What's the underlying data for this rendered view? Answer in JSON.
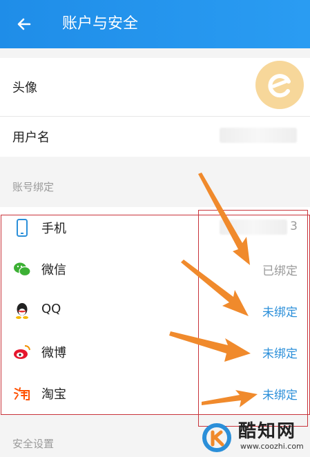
{
  "header": {
    "title": "账户与安全"
  },
  "profile": {
    "avatar_label": "头像",
    "username_label": "用户名"
  },
  "binding_section": {
    "title": "账号绑定",
    "items": [
      {
        "name": "手机",
        "status": "3",
        "icon": "phone-icon"
      },
      {
        "name": "微信",
        "status": "已绑定",
        "icon": "wechat-icon"
      },
      {
        "name": "QQ",
        "status": "未绑定",
        "icon": "qq-icon"
      },
      {
        "name": "微博",
        "status": "未绑定",
        "icon": "weibo-icon"
      },
      {
        "name": "淘宝",
        "status": "未绑定",
        "icon": "taobao-icon"
      }
    ]
  },
  "security_section": {
    "title": "安全设置"
  },
  "colors": {
    "accent": "#1f8de8",
    "bound": "#9a9a9a",
    "unbound": "#2b8fd9",
    "annotation": "#f08a2c",
    "box": "#c8333a"
  },
  "watermark": {
    "name": "酷知网",
    "url": "www.coozhi.com"
  }
}
